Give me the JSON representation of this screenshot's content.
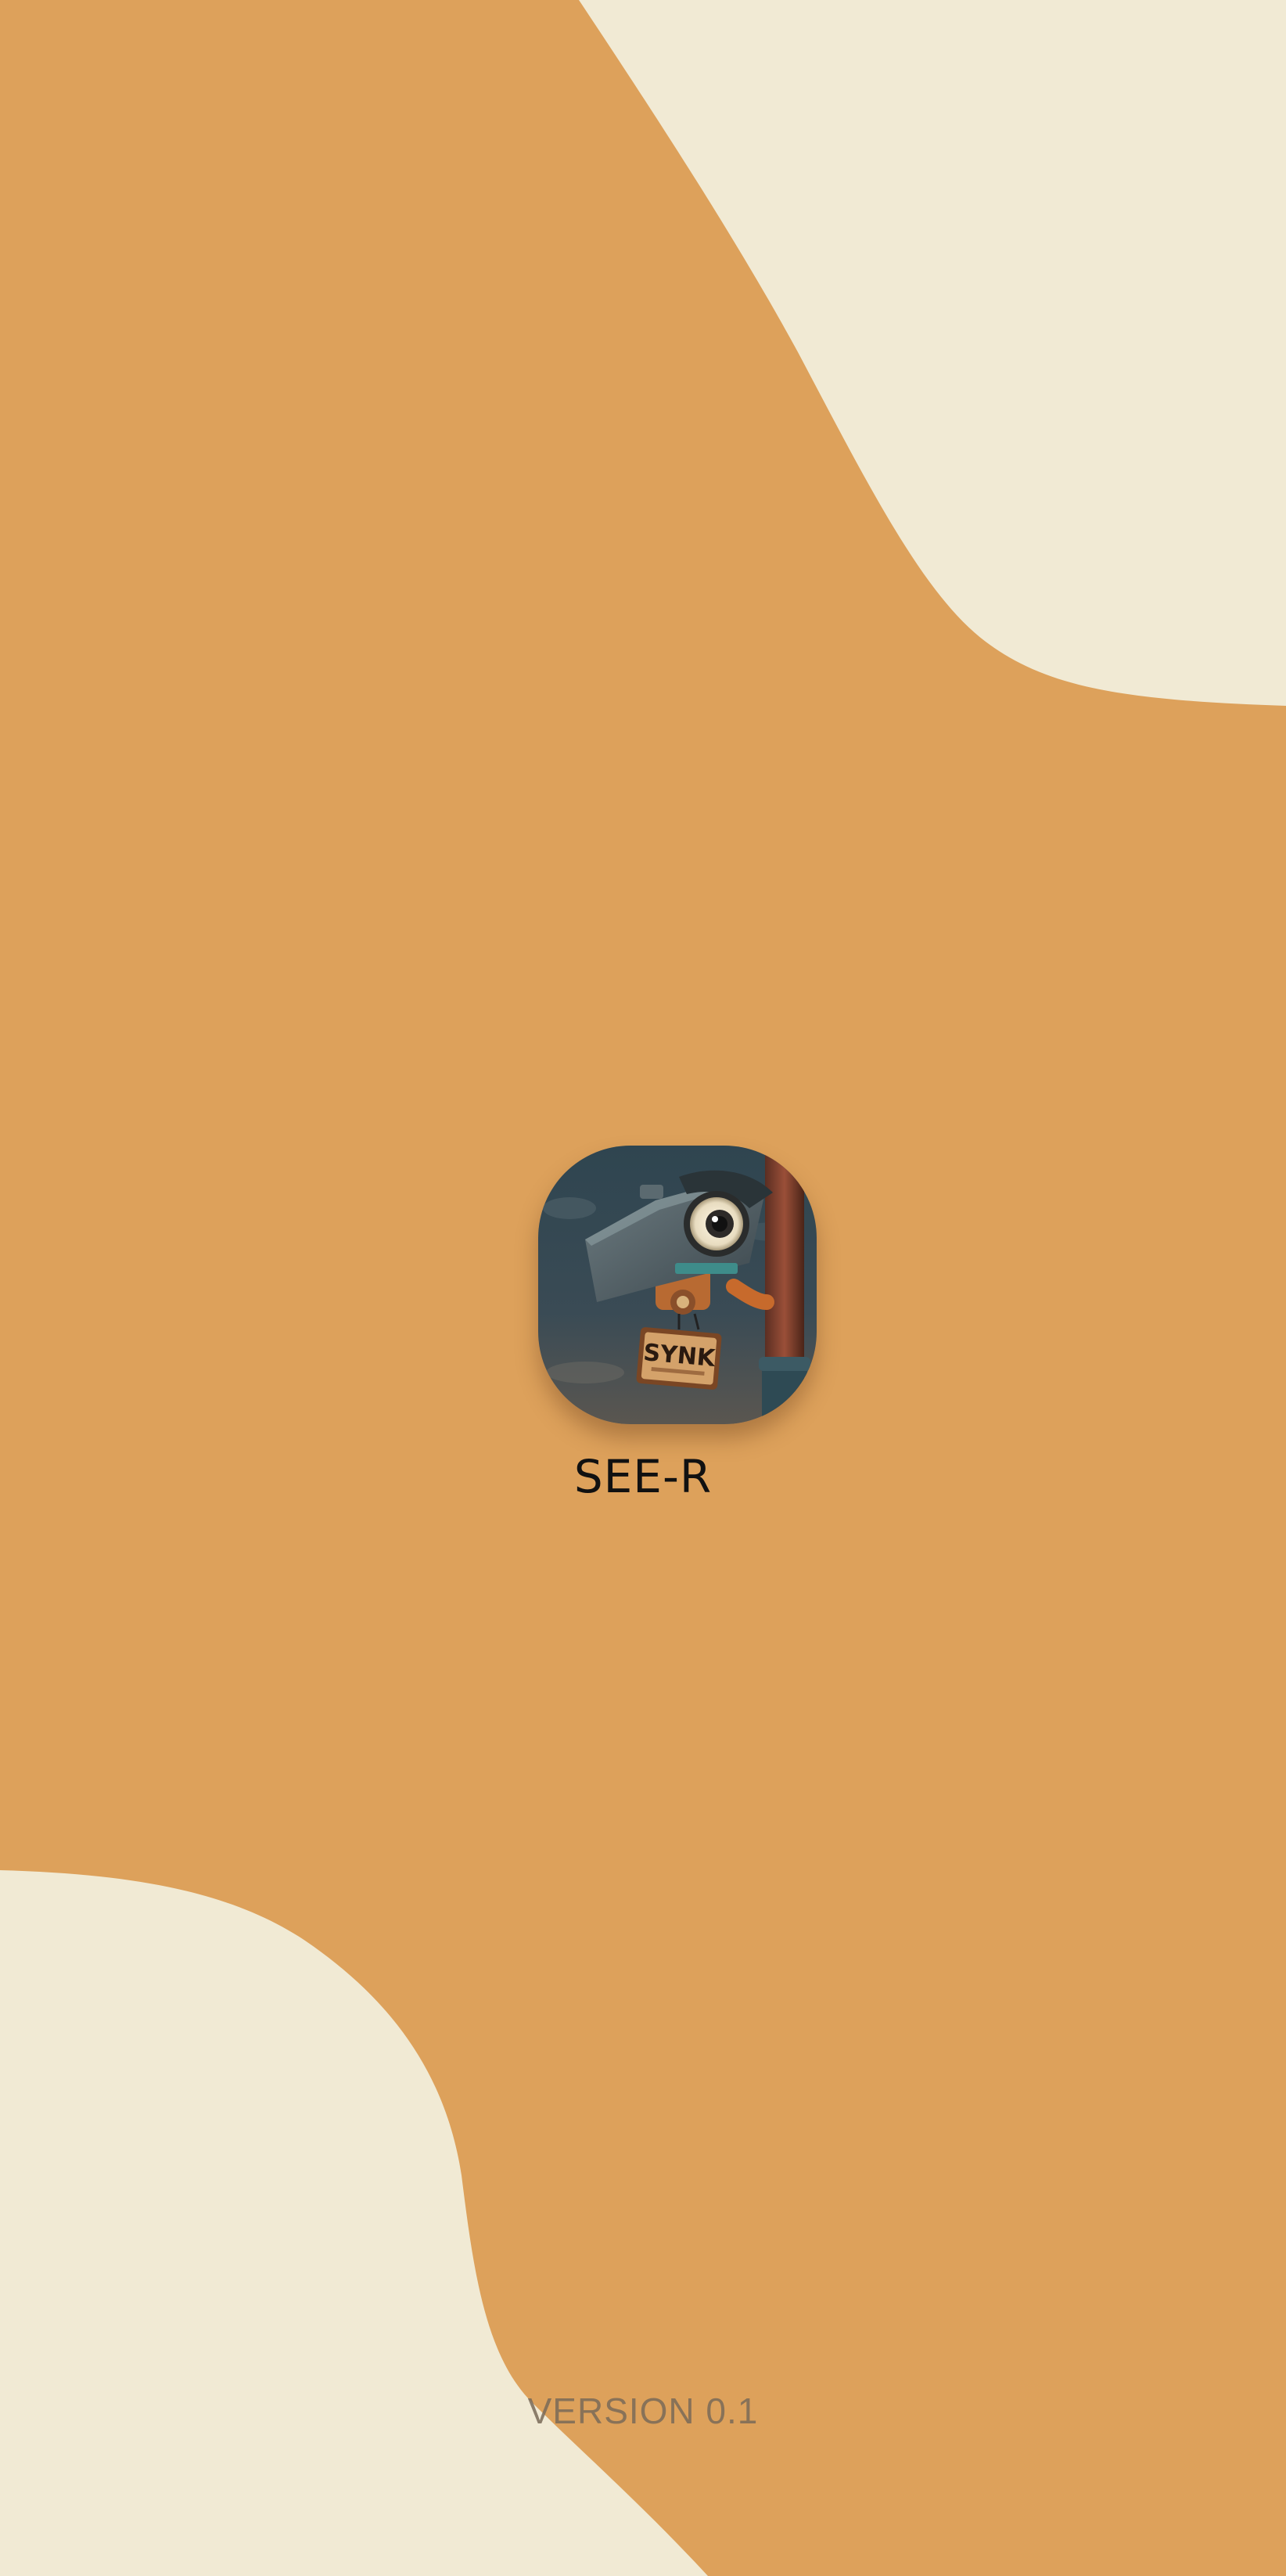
{
  "app": {
    "name": "SEE-R",
    "version": "VERSION 0.1",
    "logo_icon": "security-camera-robot-icon",
    "logo_sign_text": "SYNK"
  },
  "colors": {
    "background": "#DDA15B",
    "blob": "#F1EAD4",
    "title_text": "#111111",
    "version_text": "#7a6a58"
  }
}
